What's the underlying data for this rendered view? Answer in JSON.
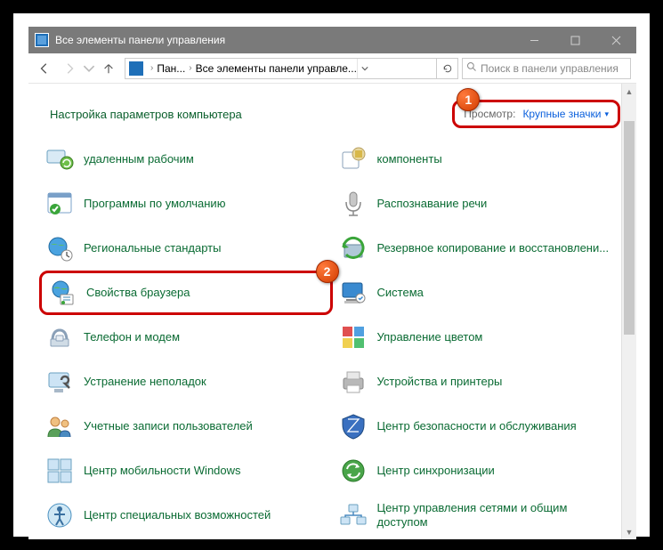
{
  "window": {
    "title": "Все элементы панели управления"
  },
  "breadcrumb": {
    "seg1": "Пан...",
    "seg2": "Все элементы панели управле..."
  },
  "search": {
    "placeholder": "Поиск в панели управления"
  },
  "header": {
    "title": "Настройка параметров компьютера",
    "view_label": "Просмотр:",
    "view_value": "Крупные значки"
  },
  "badges": {
    "b1": "1",
    "b2": "2"
  },
  "items_left": [
    "удаленным рабочим",
    "Программы по умолчанию",
    "Региональные стандарты",
    "Свойства браузера",
    "Телефон и модем",
    "Устранение неполадок",
    "Учетные записи пользователей",
    "Центр мобильности Windows",
    "Центр специальных возможностей"
  ],
  "items_right": [
    "компоненты",
    "Распознавание речи",
    "Резервное копирование и восстановлени...",
    "Система",
    "Управление цветом",
    "Устройства и принтеры",
    "Центр безопасности и обслуживания",
    "Центр синхронизации",
    "Центр управления сетями и общим доступом"
  ]
}
